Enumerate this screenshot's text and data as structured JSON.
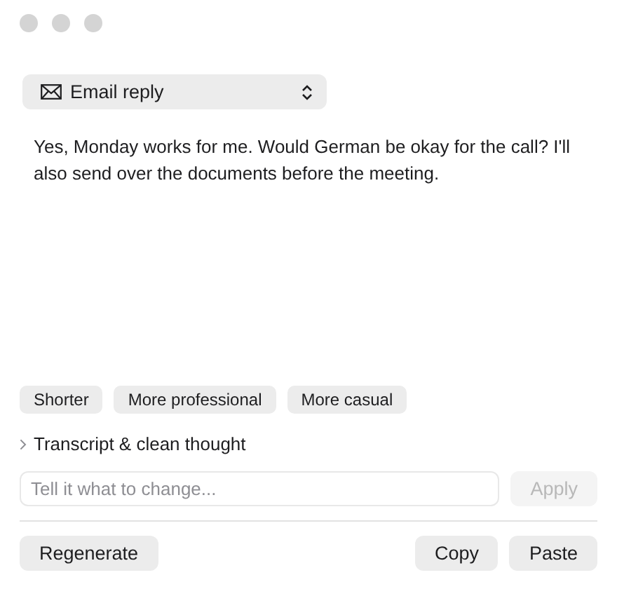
{
  "mode_select": {
    "label": "Email reply"
  },
  "reply_text": "Yes, Monday works for me. Would German be okay for the call? I'll also send over the documents before the meeting.",
  "suggestions": [
    "Shorter",
    "More professional",
    "More casual"
  ],
  "disclosure": {
    "label": "Transcript & clean thought",
    "expanded": false
  },
  "instruction": {
    "placeholder": "Tell it what to change...",
    "apply": {
      "label": "Apply",
      "disabled": true
    }
  },
  "actions": {
    "left": [
      "Regenerate"
    ],
    "right": [
      "Copy",
      "Paste"
    ]
  }
}
